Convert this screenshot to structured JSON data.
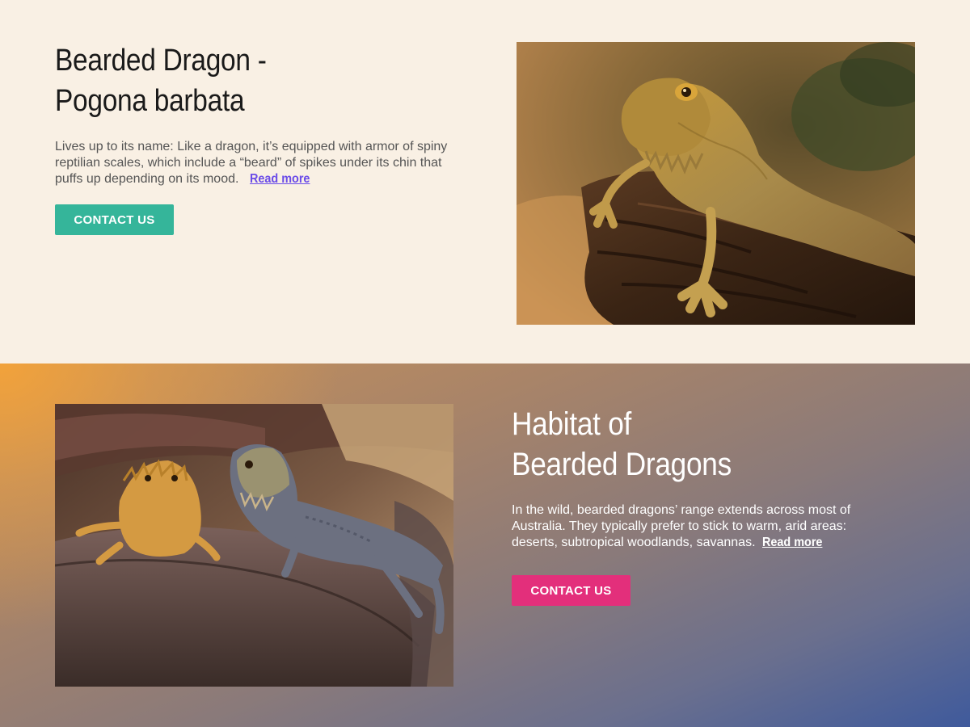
{
  "sections": [
    {
      "title_line1": "Bearded Dragon -",
      "title_line2": "Pogona barbata",
      "description": "Lives up to its name: Like a dragon, it’s equipped with armor of spiny reptilian scales, which include a “beard” of spikes under its chin that puffs up depending on its mood.",
      "read_more": "Read more",
      "button_label": "CONTACT US",
      "button_color": "#35b59a",
      "link_color": "#6b4ce8",
      "background": "#f9f0e4",
      "image_subject": "bearded-dragon-on-log"
    },
    {
      "title_line1": "Habitat of",
      "title_line2": "Bearded Dragons",
      "description": "In the wild, bearded dragons’ range extends across most of Australia. They typically prefer to stick to warm, arid areas: deserts, subtropical woodlands, savannas.",
      "read_more": "Read more",
      "button_label": "CONTACT US",
      "button_color": "#e32f7b",
      "link_color": "#ffffff",
      "background_gradient": [
        "#f4a339",
        "#8a7a7a",
        "#3f5a9c"
      ],
      "image_subject": "two-bearded-dragons-on-rock"
    }
  ]
}
